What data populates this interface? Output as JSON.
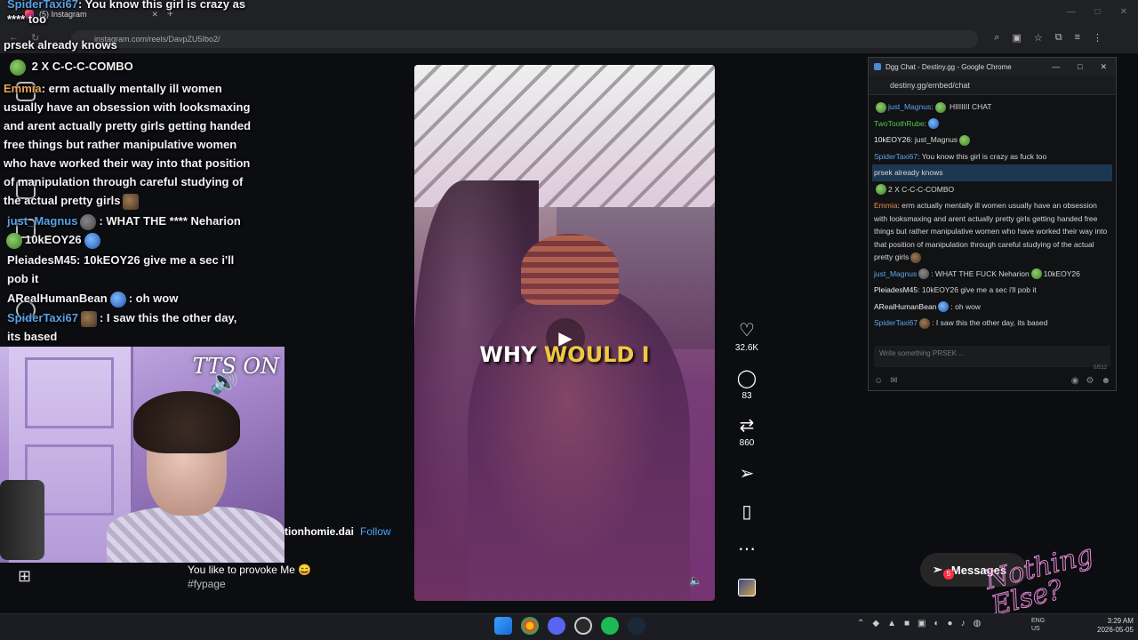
{
  "browser": {
    "tab_title": "(5) Instagram",
    "url": "instagram.com/reels/DavpZU5Ibo2/",
    "new_tab": "+",
    "close": "✕"
  },
  "overlay_chat": {
    "top_line": {
      "user": "SpiderTaxi67",
      "text": ": You know this girl is crazy as **** too"
    },
    "highlight": "prsek already knows",
    "combo": "2 X C-C-C-COMBO",
    "msg1": {
      "user": "Emmia",
      "text": ": erm actually mentally ill women usually have an obsession with looksmaxing and arent actually pretty girls getting handed free things but rather manipulative women who have worked their way into that position of manipulation through careful studying of the actual pretty girls"
    },
    "msg2": {
      "user": "just_Magnus",
      "text": ": WHAT THE **** Neharion"
    },
    "msg2b": "10kEOY26",
    "msg3": {
      "user": "PleiadesM45",
      "text": ": 10kEOY26 give me a sec i'll pob it"
    },
    "msg4": {
      "user": "ARealHumanBean",
      "text": ": oh wow"
    },
    "msg5": {
      "user": "SpiderTaxi67",
      "text": ": I saw this the other day, its based"
    }
  },
  "webcam": {
    "tts_label": "TTS ON"
  },
  "reel": {
    "caption_a": "WHY ",
    "caption_b": "WOULD I",
    "username": "tionhomie.dai",
    "follow": "Follow",
    "description": "You like to provoke Me 😄",
    "hashtag": "#fypage",
    "likes": "32.6K",
    "comments": "83",
    "reposts": "860"
  },
  "dgg": {
    "window_title": "Dgg Chat - Destiny.gg - Google Chrome",
    "url": "destiny.gg/embed/chat",
    "messages": [
      {
        "user": "just_Magnus",
        "text": " HIIIIIII CHAT",
        "ucls": "u-blue"
      },
      {
        "user": "TwoToothRube",
        "text": ":",
        "ucls": "u-green"
      },
      {
        "user": "10kEOY26",
        "text": ": just_Magnus",
        "ucls": "u-white"
      },
      {
        "user": "SpiderTaxi67",
        "text": ": You know this girl is crazy as fuck too",
        "ucls": "u-blue"
      }
    ],
    "highlight": "prsek already knows",
    "combo": "2 X C-C-C-COMBO",
    "long_msg": {
      "user": "Emmia",
      "text": ": erm actually mentally ill women usually have an obsession with looksmaxing and arent actually pretty girls getting handed free things but rather manipulative women who have worked their way into that position of manipulation through careful studying of the actual pretty girls"
    },
    "msg_magnus": {
      "user": "just_Magnus",
      "text": ": WHAT THE FUCK Neharion",
      "tail": "10kEOY26"
    },
    "msg_pleiades": {
      "user": "PleiadesM45",
      "text": ": 10kEOY26 give me a sec i'll pob it"
    },
    "msg_bean": {
      "user": "ARealHumanBean",
      "text": ": oh wow"
    },
    "msg_spider": {
      "user": "SpiderTaxi67",
      "text": ": I saw this the other day, its based"
    },
    "input_placeholder": "Write something PRSEK ...",
    "char_count": "0/512"
  },
  "messages_btn": {
    "label": "Messages",
    "badge": "5"
  },
  "stream_overlay_text": "Nothing Else?",
  "taskbar": {
    "lang": "ENG",
    "region": "US",
    "time": "3:29 AM",
    "date": "2026-05-05"
  },
  "colors": {
    "instagram_blue": "#4aa3ff",
    "dgg_highlight": "#1c3752",
    "overlay_pink": "#e38bd4"
  }
}
